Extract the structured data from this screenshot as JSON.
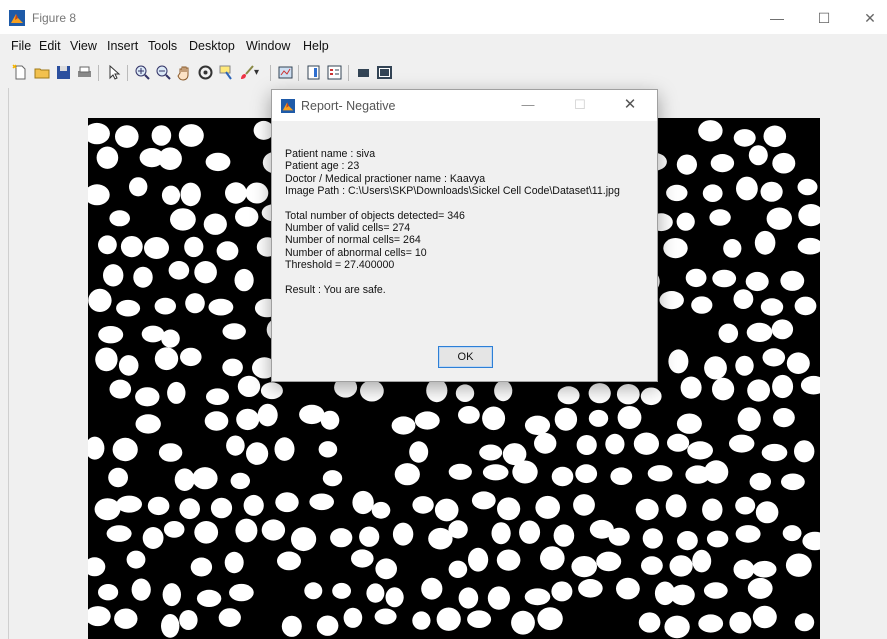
{
  "window": {
    "title": "Figure 8",
    "minimize": "—",
    "maximize": "☐",
    "close": "✕"
  },
  "menu": [
    "File",
    "Edit",
    "View",
    "Insert",
    "Tools",
    "Desktop",
    "Window",
    "Help"
  ],
  "toolbar": {
    "icons": [
      "new-figure-icon",
      "open-file-icon",
      "save-icon",
      "print-icon",
      "edit-plot-icon",
      "zoom-in-icon",
      "zoom-out-icon",
      "pan-icon",
      "rotate-3d-icon",
      "data-cursor-icon",
      "brush-icon",
      "brush-dropdown-icon",
      "link-plot-icon",
      "insert-colorbar-icon",
      "insert-legend-icon",
      "hide-plot-tools-icon",
      "show-plot-tools-icon"
    ]
  },
  "dialog": {
    "title": "Report- Negative",
    "minimize": "—",
    "maximize": "☐",
    "close": "✕",
    "lines": {
      "patient_name": "Patient name : siva",
      "patient_age": "Patient age : 23",
      "doctor": "Doctor / Medical practioner name : Kaavya",
      "image_path": "Image Path : C:\\Users\\SKP\\Downloads\\Sickel Cell Code\\Dataset\\11.jpg",
      "total_objects": "Total number of objects detected=  346",
      "valid_cells": "Number of valid cells=  274",
      "normal_cells": "Number of normal cells=  264",
      "abnormal_cells": "Number of abnormal cells=  10",
      "threshold": "Threshold =  27.400000",
      "result": "Result : You are safe."
    },
    "ok_label": "OK"
  }
}
